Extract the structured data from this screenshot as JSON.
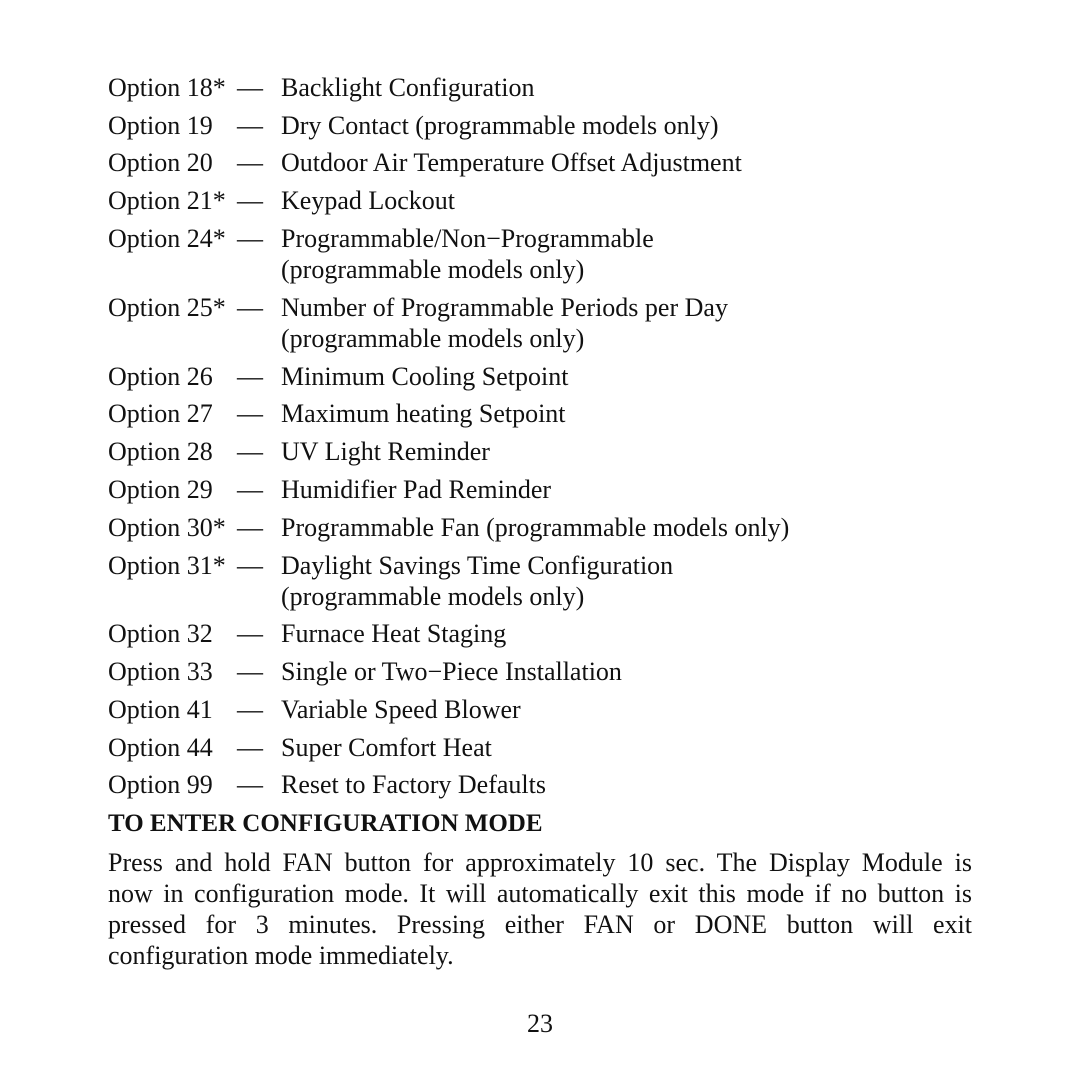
{
  "options": [
    {
      "label": "Option 18*",
      "dash": "—",
      "desc": "Backlight Configuration"
    },
    {
      "label": "Option 19",
      "dash": "—",
      "desc": "Dry Contact (programmable models only)"
    },
    {
      "label": "Option 20",
      "dash": "—",
      "desc": "Outdoor Air Temperature Offset Adjustment"
    },
    {
      "label": "Option 21*",
      "dash": "—",
      "desc": "Keypad Lockout"
    },
    {
      "label": "Option 24*",
      "dash": "—",
      "desc": "Programmable/Non−Programmable",
      "cont": "(programmable models only)"
    },
    {
      "label": "Option 25*",
      "dash": "—",
      "desc": "Number of Programmable Periods per Day",
      "cont": "(programmable models only)"
    },
    {
      "label": "Option 26",
      "dash": "—",
      "desc": "Minimum Cooling Setpoint"
    },
    {
      "label": "Option 27",
      "dash": "—",
      "desc": "Maximum heating Setpoint"
    },
    {
      "label": "Option 28",
      "dash": "—",
      "desc": "UV Light Reminder"
    },
    {
      "label": "Option 29",
      "dash": "—",
      "desc": "Humidifier Pad Reminder"
    },
    {
      "label": "Option 30*",
      "dash": "—",
      "desc": "Programmable Fan (programmable models only)"
    },
    {
      "label": "Option 31*",
      "dash": "—",
      "desc": "Daylight Savings Time Configuration",
      "cont": "(programmable models only)"
    },
    {
      "label": "Option 32",
      "dash": "—",
      "desc": "Furnace Heat Staging"
    },
    {
      "label": "Option 33",
      "dash": "—",
      "desc": "Single or Two−Piece Installation"
    },
    {
      "label": "Option 41",
      "dash": "—",
      "desc": "Variable Speed Blower"
    },
    {
      "label": "Option 44",
      "dash": "—",
      "desc": "Super Comfort Heat"
    },
    {
      "label": "Option 99",
      "dash": "—",
      "desc": "Reset to Factory Defaults"
    }
  ],
  "heading": "TO ENTER CONFIGURATION MODE",
  "paragraph_lines": [
    "Press and hold FAN button for approximately 10 sec. The Display Module is",
    "now in configuration mode. It will automatically exit this mode if no button is",
    "pressed for 3 minutes. Pressing either FAN or DONE button will exit",
    "configuration mode immediately."
  ],
  "page_number": "23"
}
